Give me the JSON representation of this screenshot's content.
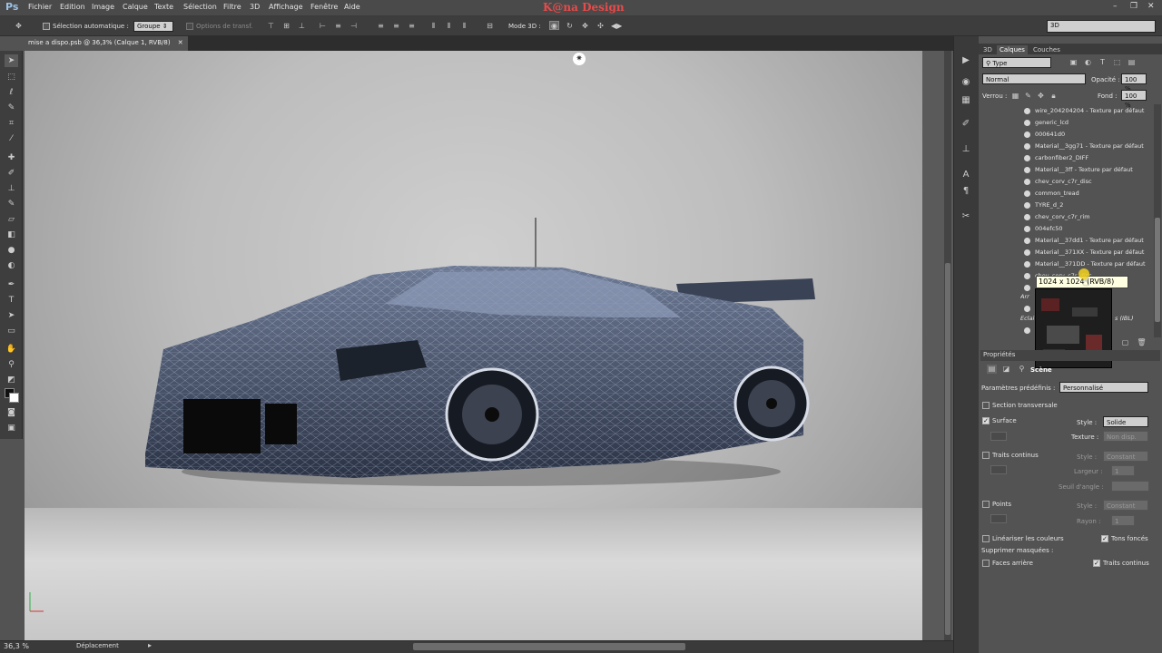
{
  "menu": [
    "Fichier",
    "Edition",
    "Image",
    "Calque",
    "Texte",
    "Sélection",
    "Filtre",
    "3D",
    "Affichage",
    "Fenêtre",
    "Aide"
  ],
  "brand": "K@na Design",
  "app_logo": "Ps",
  "options": {
    "auto_select_label": "Sélection automatique :",
    "group_value": "Groupe",
    "transform_label": "Options de transf.",
    "mode3d_label": "Mode 3D :"
  },
  "workspace": "3D",
  "document_tab": "mise a dispo.psb @ 36,3% (Calque 1, RVB/8)",
  "status": {
    "zoom": "36,3 %",
    "label": "Déplacement"
  },
  "panel_tabs": [
    "3D",
    "Calques",
    "Couches"
  ],
  "layers_panel": {
    "filter": "Type",
    "blend_mode": "Normal",
    "opacity_label": "Opacité :",
    "opacity": "100 %",
    "lock_label": "Verrou :",
    "fill_label": "Fond :",
    "fill": "100 %",
    "items": [
      "wire_204204204 - Texture par défaut",
      "generic_lcd",
      "000641d0",
      "Material__3gg71 - Texture par défaut",
      "carbonfiber2_DIFF",
      "Material__3ff - Texture par défaut",
      "chev_corv_c7r_disc",
      "common_tread",
      "TYRE_d_2",
      "chev_corv_c7r_rim",
      "004efc50",
      "Material__37dd1 - Texture par défaut",
      "Material__371XX - Texture par défaut",
      "Material__371DD - Texture par défaut",
      "chev_corv_c7r_disc"
    ],
    "tooltip": "1024 x 1024 (RVB/8)",
    "partial_text_1": "Arr",
    "partial_text_2": "Eclai",
    "partial_text_3": "s (IBL)"
  },
  "properties": {
    "tab": "Propriétés",
    "scene_label": "Scène",
    "preset_label": "Paramètres prédéfinis :",
    "preset_value": "Personnalisé",
    "cross_section": "Section transversale",
    "surface": "Surface",
    "style_label": "Style :",
    "surface_style": "Solide",
    "texture_label": "Texture :",
    "texture_value": "Non disp.",
    "lines": "Traits continus",
    "lines_style": "Constant",
    "width_label": "Largeur :",
    "width_value": "1",
    "angle_label": "Seuil d'angle :",
    "points": "Points",
    "points_style": "Constant",
    "radius_label": "Rayon :",
    "radius_value": "1",
    "linearize": "Linéariser les couleurs",
    "dark_tones": "Tons foncés",
    "remove_hidden": "Supprimer masquées :",
    "back_faces": "Faces arrière",
    "continuous_lines": "Traits continus"
  }
}
